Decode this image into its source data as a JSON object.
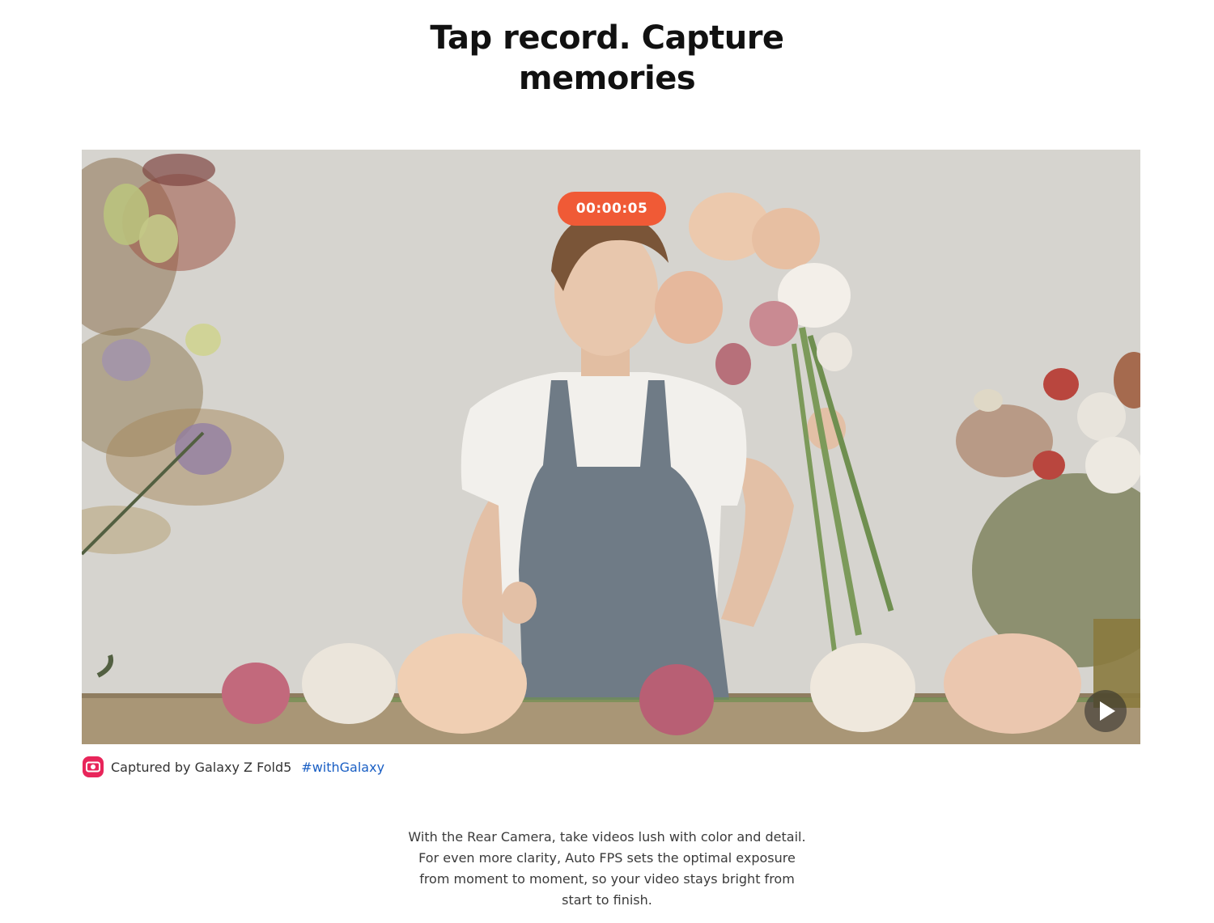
{
  "headline": {
    "line1": "Tap record. Capture",
    "line2": "memories"
  },
  "video": {
    "timer": "00:00:05",
    "play_icon": "play-icon"
  },
  "caption": {
    "icon": "camera-icon",
    "text": "Captured by Galaxy Z Fold5",
    "hashtag": "#withGalaxy"
  },
  "description": {
    "lines": [
      "With the Rear Camera, take videos lush with color and detail.",
      "For even more clarity, Auto FPS sets the optimal exposure",
      "from moment to moment, so your video stays bright from",
      "start to finish."
    ]
  },
  "colors": {
    "timer_bg": "#f05a36",
    "hashtag": "#1a5fc4",
    "camera_icon": "#e8255a"
  }
}
